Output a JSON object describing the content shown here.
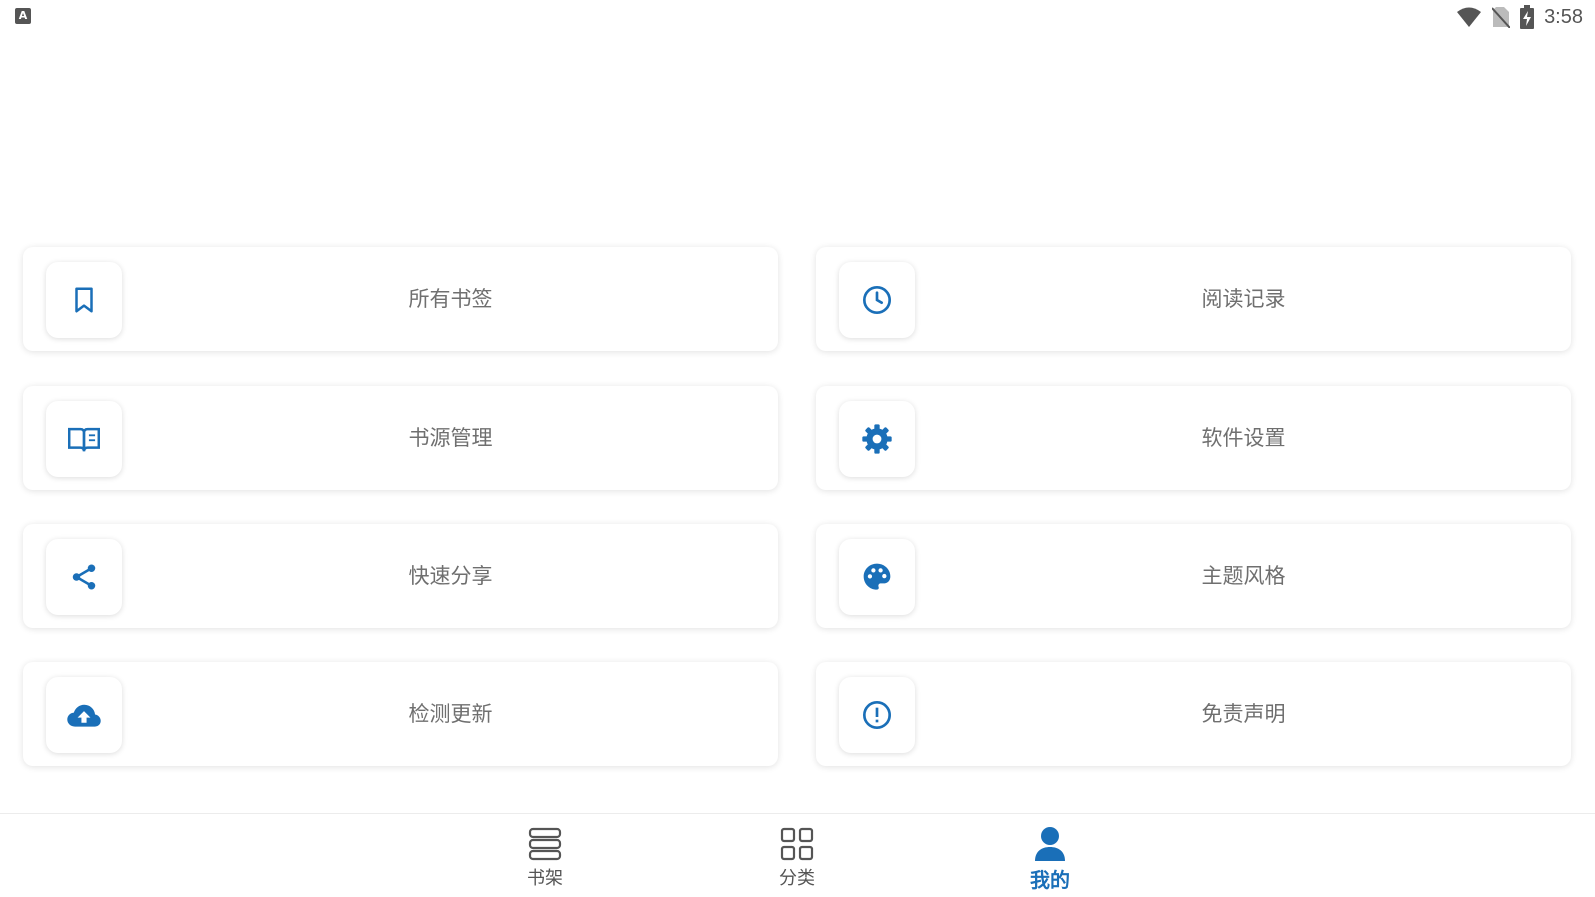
{
  "status_bar": {
    "app_badge": "A",
    "time": "3:58"
  },
  "colors": {
    "accent": "#1a6fb8",
    "label_text": "#6f6f6f",
    "nav_text": "#555555"
  },
  "menu": [
    {
      "label": "所有书签",
      "icon": "bookmark-icon"
    },
    {
      "label": "阅读记录",
      "icon": "clock-icon"
    },
    {
      "label": "书源管理",
      "icon": "book-open-icon"
    },
    {
      "label": "软件设置",
      "icon": "gear-icon"
    },
    {
      "label": "快速分享",
      "icon": "share-icon"
    },
    {
      "label": "主题风格",
      "icon": "palette-icon"
    },
    {
      "label": "检测更新",
      "icon": "cloud-upload-icon"
    },
    {
      "label": "免责声明",
      "icon": "alert-circle-icon"
    }
  ],
  "bottom_nav": {
    "items": [
      {
        "label": "书架",
        "icon": "bookshelf-icon"
      },
      {
        "label": "分类",
        "icon": "grid-icon"
      },
      {
        "label": "我的",
        "icon": "person-icon",
        "active": true
      }
    ]
  }
}
